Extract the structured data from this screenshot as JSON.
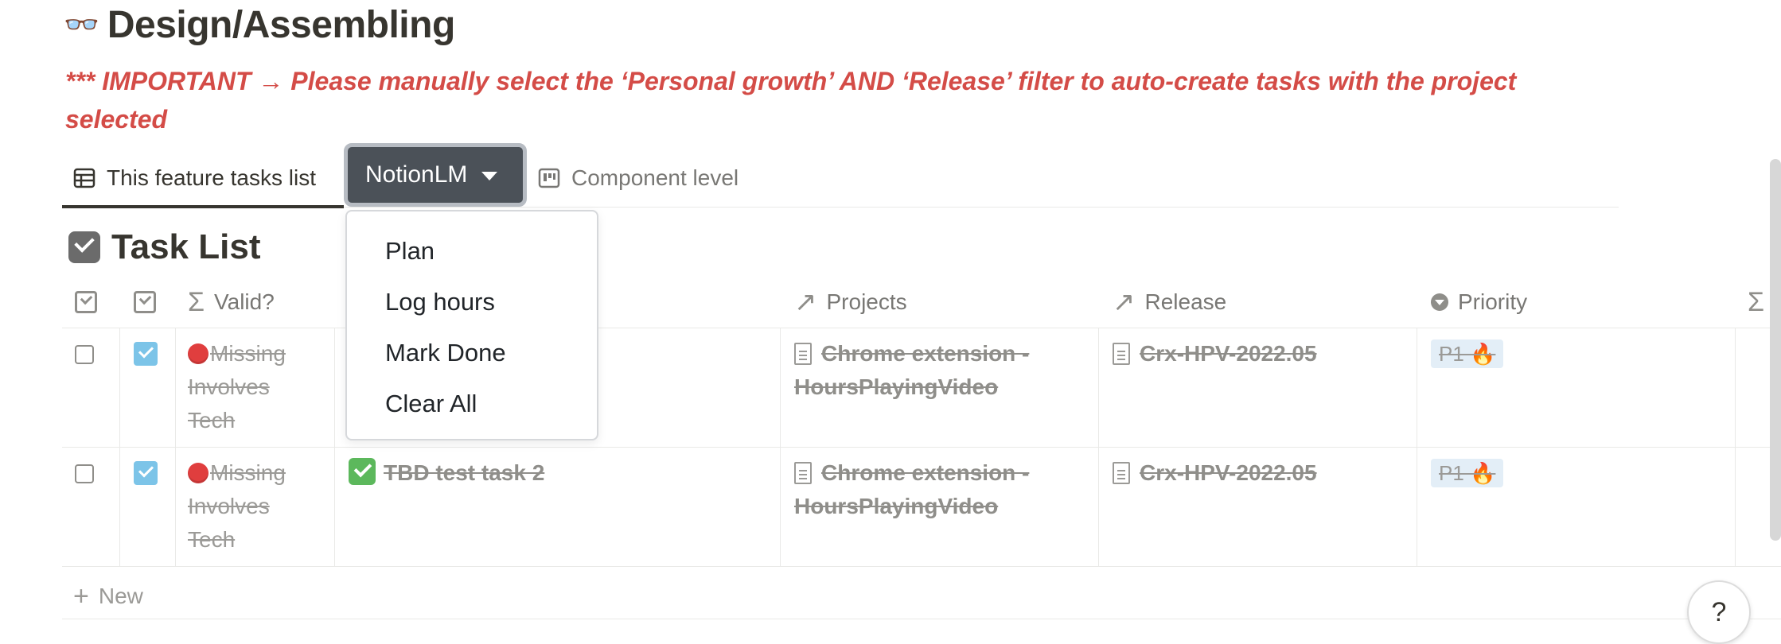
{
  "page": {
    "title_emoji": "👓",
    "title": "Design/Assembling",
    "notice": "*** IMPORTANT → Please manually select the ‘Personal growth’ AND ‘Release’ filter to auto-create tasks with the project selected"
  },
  "tabs": {
    "tab1_label": "This feature tasks list",
    "dropdown_label": "NotionLM",
    "tab3_label": "Component level"
  },
  "dropdown_menu": {
    "items": [
      "Plan",
      "Log hours",
      "Mark Done",
      "Clear All"
    ]
  },
  "section": {
    "title": "Task List"
  },
  "table": {
    "headers": {
      "valid": "Valid?",
      "projects": "Projects",
      "release": "Release",
      "priority": "Priority"
    },
    "rows": [
      {
        "checked": false,
        "done": true,
        "valid": "Missing Involves Tech",
        "task": "",
        "project": "Chrome extension - HoursPlayingVideo",
        "release": "Crx-HPV-2022.05",
        "priority": "P1 🔥"
      },
      {
        "checked": false,
        "done": true,
        "valid": "Missing Involves Tech",
        "task": "TBD test task 2",
        "project": "Chrome extension - HoursPlayingVideo",
        "release": "Crx-HPV-2022.05",
        "priority": "P1 🔥"
      }
    ],
    "new_label": "New"
  },
  "help": {
    "label": "?"
  },
  "colors": {
    "accent_red": "#d44c47",
    "dropdown_bg": "#4b5158",
    "checked_blue": "#7cc4e8",
    "tag_bg": "#e3eef7"
  }
}
